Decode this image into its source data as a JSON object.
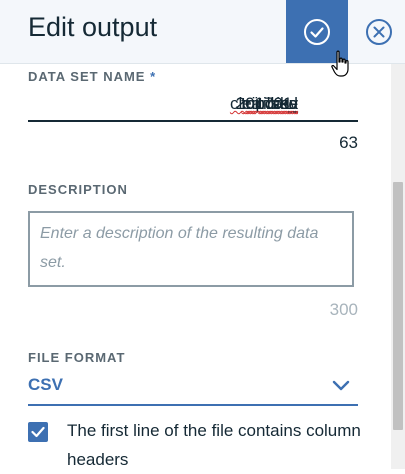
{
  "header": {
    "title": "Edit output",
    "confirm_icon": "check-circle-icon",
    "close_icon": "close-circle-icon"
  },
  "dataset_name": {
    "label": "DATA SET NAME",
    "required_marker": "*",
    "value_prefix": "201701-",
    "value_word1": "citibike",
    "value_sep1": "-",
    "value_word2": "tripdata",
    "value_sep2": "_",
    "value_word3": "cleansed",
    "value_suffix": ".csv",
    "counter": "63"
  },
  "description": {
    "label": "DESCRIPTION",
    "placeholder": "Enter a description of the resulting data set.",
    "counter": "300"
  },
  "file_format": {
    "label": "FILE FORMAT",
    "selected": "CSV"
  },
  "header_checkbox": {
    "checked": true,
    "label": "The first line of the file contains column headers"
  },
  "colors": {
    "accent": "#3d70b2",
    "header_bg": "#f4f7fb",
    "text": "#152935",
    "muted": "#8c9ba5"
  }
}
